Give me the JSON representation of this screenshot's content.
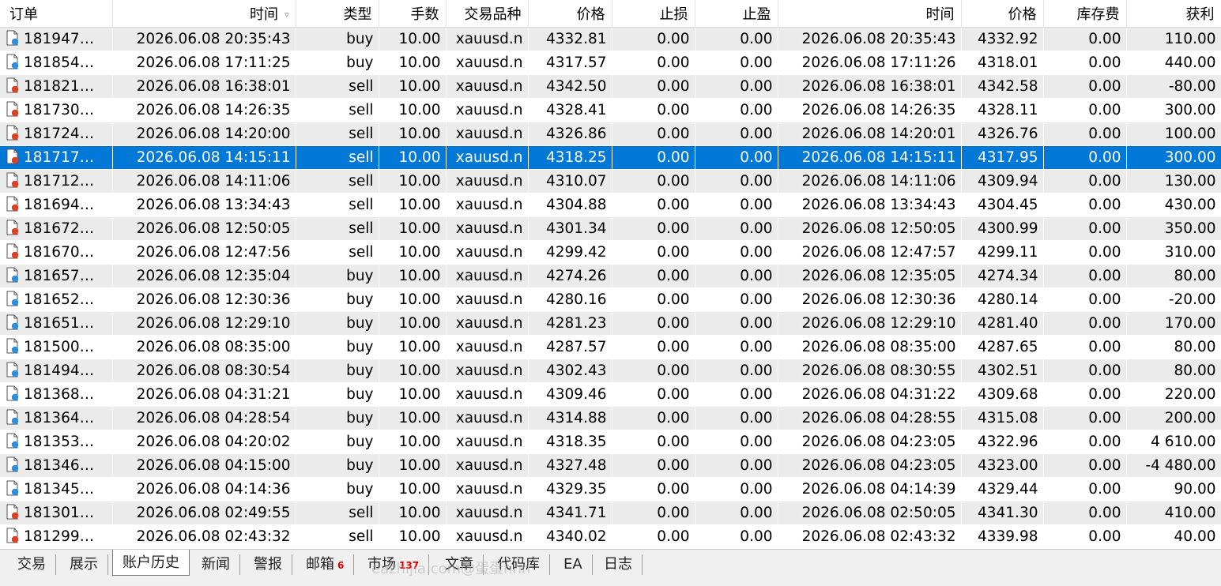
{
  "columns": [
    "订单",
    "时间",
    "类型",
    "手数",
    "交易品种",
    "价格",
    "止损",
    "止盈",
    "时间",
    "价格",
    "库存费",
    "获利"
  ],
  "sort_indicator": "▿",
  "colors": {
    "selection": "#0078d7",
    "buy_dot": "#2b8ee0",
    "sell_dot": "#e04020"
  },
  "selected_row": 5,
  "rows": [
    {
      "order": "181947…",
      "time": "2026.06.08 20:35:43",
      "type": "buy",
      "volume": "10.00",
      "symbol": "xauusd.n",
      "price": "4332.81",
      "sl": "0.00",
      "tp": "0.00",
      "close_time": "2026.06.08 20:35:43",
      "close_price": "4332.92",
      "swap": "0.00",
      "profit": "110.00"
    },
    {
      "order": "181854…",
      "time": "2026.06.08 17:11:25",
      "type": "buy",
      "volume": "10.00",
      "symbol": "xauusd.n",
      "price": "4317.57",
      "sl": "0.00",
      "tp": "0.00",
      "close_time": "2026.06.08 17:11:26",
      "close_price": "4318.01",
      "swap": "0.00",
      "profit": "440.00"
    },
    {
      "order": "181821…",
      "time": "2026.06.08 16:38:01",
      "type": "sell",
      "volume": "10.00",
      "symbol": "xauusd.n",
      "price": "4342.50",
      "sl": "0.00",
      "tp": "0.00",
      "close_time": "2026.06.08 16:38:01",
      "close_price": "4342.58",
      "swap": "0.00",
      "profit": "-80.00"
    },
    {
      "order": "181730…",
      "time": "2026.06.08 14:26:35",
      "type": "sell",
      "volume": "10.00",
      "symbol": "xauusd.n",
      "price": "4328.41",
      "sl": "0.00",
      "tp": "0.00",
      "close_time": "2026.06.08 14:26:35",
      "close_price": "4328.11",
      "swap": "0.00",
      "profit": "300.00"
    },
    {
      "order": "181724…",
      "time": "2026.06.08 14:20:00",
      "type": "sell",
      "volume": "10.00",
      "symbol": "xauusd.n",
      "price": "4326.86",
      "sl": "0.00",
      "tp": "0.00",
      "close_time": "2026.06.08 14:20:01",
      "close_price": "4326.76",
      "swap": "0.00",
      "profit": "100.00"
    },
    {
      "order": "181717…",
      "time": "2026.06.08 14:15:11",
      "type": "sell",
      "volume": "10.00",
      "symbol": "xauusd.n",
      "price": "4318.25",
      "sl": "0.00",
      "tp": "0.00",
      "close_time": "2026.06.08 14:15:11",
      "close_price": "4317.95",
      "swap": "0.00",
      "profit": "300.00"
    },
    {
      "order": "181712…",
      "time": "2026.06.08 14:11:06",
      "type": "sell",
      "volume": "10.00",
      "symbol": "xauusd.n",
      "price": "4310.07",
      "sl": "0.00",
      "tp": "0.00",
      "close_time": "2026.06.08 14:11:06",
      "close_price": "4309.94",
      "swap": "0.00",
      "profit": "130.00"
    },
    {
      "order": "181694…",
      "time": "2026.06.08 13:34:43",
      "type": "sell",
      "volume": "10.00",
      "symbol": "xauusd.n",
      "price": "4304.88",
      "sl": "0.00",
      "tp": "0.00",
      "close_time": "2026.06.08 13:34:43",
      "close_price": "4304.45",
      "swap": "0.00",
      "profit": "430.00"
    },
    {
      "order": "181672…",
      "time": "2026.06.08 12:50:05",
      "type": "sell",
      "volume": "10.00",
      "symbol": "xauusd.n",
      "price": "4301.34",
      "sl": "0.00",
      "tp": "0.00",
      "close_time": "2026.06.08 12:50:05",
      "close_price": "4300.99",
      "swap": "0.00",
      "profit": "350.00"
    },
    {
      "order": "181670…",
      "time": "2026.06.08 12:47:56",
      "type": "sell",
      "volume": "10.00",
      "symbol": "xauusd.n",
      "price": "4299.42",
      "sl": "0.00",
      "tp": "0.00",
      "close_time": "2026.06.08 12:47:57",
      "close_price": "4299.11",
      "swap": "0.00",
      "profit": "310.00"
    },
    {
      "order": "181657…",
      "time": "2026.06.08 12:35:04",
      "type": "buy",
      "volume": "10.00",
      "symbol": "xauusd.n",
      "price": "4274.26",
      "sl": "0.00",
      "tp": "0.00",
      "close_time": "2026.06.08 12:35:05",
      "close_price": "4274.34",
      "swap": "0.00",
      "profit": "80.00"
    },
    {
      "order": "181652…",
      "time": "2026.06.08 12:30:36",
      "type": "buy",
      "volume": "10.00",
      "symbol": "xauusd.n",
      "price": "4280.16",
      "sl": "0.00",
      "tp": "0.00",
      "close_time": "2026.06.08 12:30:36",
      "close_price": "4280.14",
      "swap": "0.00",
      "profit": "-20.00"
    },
    {
      "order": "181651…",
      "time": "2026.06.08 12:29:10",
      "type": "buy",
      "volume": "10.00",
      "symbol": "xauusd.n",
      "price": "4281.23",
      "sl": "0.00",
      "tp": "0.00",
      "close_time": "2026.06.08 12:29:10",
      "close_price": "4281.40",
      "swap": "0.00",
      "profit": "170.00"
    },
    {
      "order": "181500…",
      "time": "2026.06.08 08:35:00",
      "type": "buy",
      "volume": "10.00",
      "symbol": "xauusd.n",
      "price": "4287.57",
      "sl": "0.00",
      "tp": "0.00",
      "close_time": "2026.06.08 08:35:00",
      "close_price": "4287.65",
      "swap": "0.00",
      "profit": "80.00"
    },
    {
      "order": "181494…",
      "time": "2026.06.08 08:30:54",
      "type": "buy",
      "volume": "10.00",
      "symbol": "xauusd.n",
      "price": "4302.43",
      "sl": "0.00",
      "tp": "0.00",
      "close_time": "2026.06.08 08:30:55",
      "close_price": "4302.51",
      "swap": "0.00",
      "profit": "80.00"
    },
    {
      "order": "181368…",
      "time": "2026.06.08 04:31:21",
      "type": "buy",
      "volume": "10.00",
      "symbol": "xauusd.n",
      "price": "4309.46",
      "sl": "0.00",
      "tp": "0.00",
      "close_time": "2026.06.08 04:31:22",
      "close_price": "4309.68",
      "swap": "0.00",
      "profit": "220.00"
    },
    {
      "order": "181364…",
      "time": "2026.06.08 04:28:54",
      "type": "buy",
      "volume": "10.00",
      "symbol": "xauusd.n",
      "price": "4314.88",
      "sl": "0.00",
      "tp": "0.00",
      "close_time": "2026.06.08 04:28:55",
      "close_price": "4315.08",
      "swap": "0.00",
      "profit": "200.00"
    },
    {
      "order": "181353…",
      "time": "2026.06.08 04:20:02",
      "type": "buy",
      "volume": "10.00",
      "symbol": "xauusd.n",
      "price": "4318.35",
      "sl": "0.00",
      "tp": "0.00",
      "close_time": "2026.06.08 04:23:05",
      "close_price": "4322.96",
      "swap": "0.00",
      "profit": "4 610.00"
    },
    {
      "order": "181346…",
      "time": "2026.06.08 04:15:00",
      "type": "buy",
      "volume": "10.00",
      "symbol": "xauusd.n",
      "price": "4327.48",
      "sl": "0.00",
      "tp": "0.00",
      "close_time": "2026.06.08 04:23:05",
      "close_price": "4323.00",
      "swap": "0.00",
      "profit": "-4 480.00"
    },
    {
      "order": "181345…",
      "time": "2026.06.08 04:14:36",
      "type": "buy",
      "volume": "10.00",
      "symbol": "xauusd.n",
      "price": "4329.35",
      "sl": "0.00",
      "tp": "0.00",
      "close_time": "2026.06.08 04:14:39",
      "close_price": "4329.44",
      "swap": "0.00",
      "profit": "90.00"
    },
    {
      "order": "181301…",
      "time": "2026.06.08 02:49:55",
      "type": "sell",
      "volume": "10.00",
      "symbol": "xauusd.n",
      "price": "4341.71",
      "sl": "0.00",
      "tp": "0.00",
      "close_time": "2026.06.08 02:50:05",
      "close_price": "4341.30",
      "swap": "0.00",
      "profit": "410.00"
    },
    {
      "order": "181299…",
      "time": "2026.06.08 02:43:32",
      "type": "sell",
      "volume": "10.00",
      "symbol": "xauusd.n",
      "price": "4340.02",
      "sl": "0.00",
      "tp": "0.00",
      "close_time": "2026.06.08 02:43:32",
      "close_price": "4339.98",
      "swap": "0.00",
      "profit": "40.00"
    }
  ],
  "tabs": [
    {
      "label": "交易"
    },
    {
      "label": "展示"
    },
    {
      "label": "账户历史",
      "active": true
    },
    {
      "label": "新闻"
    },
    {
      "label": "警报"
    },
    {
      "label": "邮箱",
      "badge": "6"
    },
    {
      "label": "市场",
      "badge": "137"
    },
    {
      "label": "文章"
    },
    {
      "label": "代码库"
    },
    {
      "label": "EA"
    },
    {
      "label": "日志"
    }
  ],
  "watermark": "eazhijia.com@蛋蛋nnn"
}
